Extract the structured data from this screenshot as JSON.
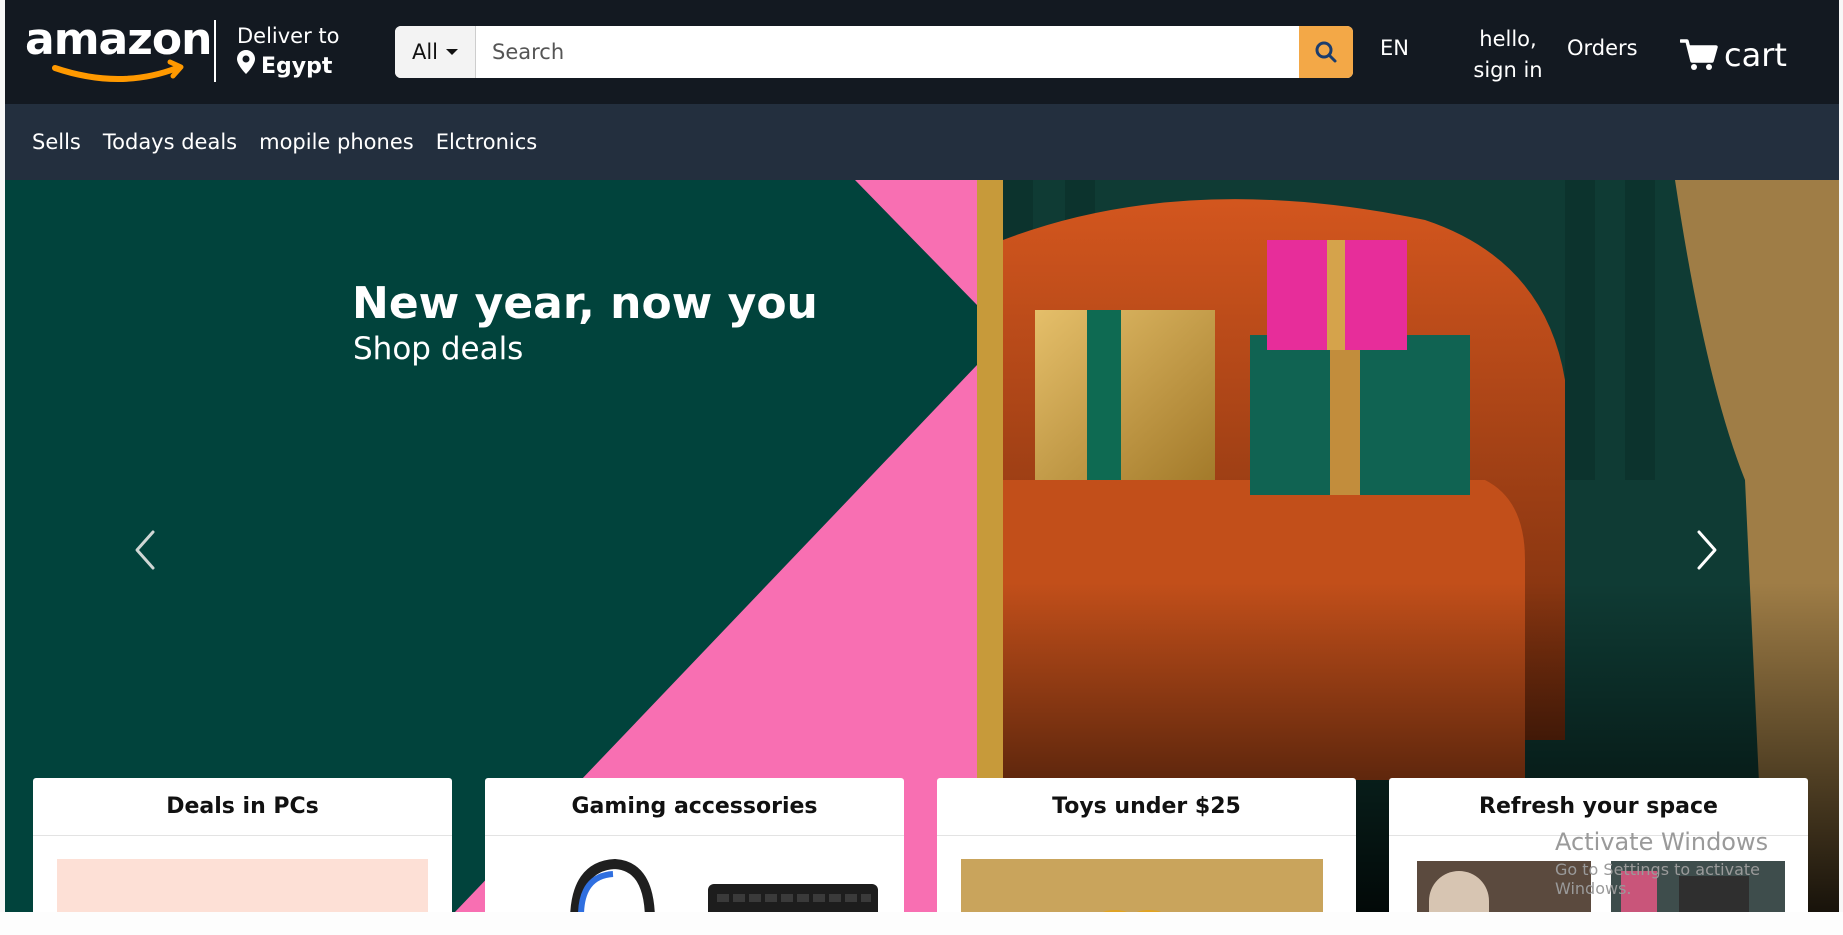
{
  "header": {
    "logo_text": "amazon",
    "deliver_label": "Deliver to",
    "deliver_location": "Egypt",
    "search": {
      "category": "All",
      "placeholder": "Search"
    },
    "language": "EN",
    "signin_line1": "hello,",
    "signin_line2": "sign in",
    "orders": "Orders",
    "cart": "cart"
  },
  "subnav": {
    "items": [
      {
        "label": "Sells"
      },
      {
        "label": "Todays deals"
      },
      {
        "label": "mopile phones"
      },
      {
        "label": "Elctronics"
      }
    ]
  },
  "hero": {
    "title": "New year, now you",
    "subtitle": "Shop deals"
  },
  "cards": [
    {
      "title": "Deals in PCs"
    },
    {
      "title": "Gaming accessories"
    },
    {
      "title": "Toys under $25"
    },
    {
      "title": "Refresh your space"
    }
  ],
  "system": {
    "activation_title": "Activate Windows",
    "activation_subtitle": "Go to Settings to activate Windows."
  },
  "colors": {
    "header_bg": "#131921",
    "subnav_bg": "#232f3e",
    "search_button": "#f3a847",
    "logo_smile": "#ff9900",
    "hero_green": "#01433c",
    "hero_pink": "#f86fb2"
  },
  "icons": {
    "location": "map-pin-icon",
    "search": "search-icon",
    "cart": "cart-icon",
    "prev": "chevron-left-icon",
    "next": "chevron-right-icon"
  }
}
